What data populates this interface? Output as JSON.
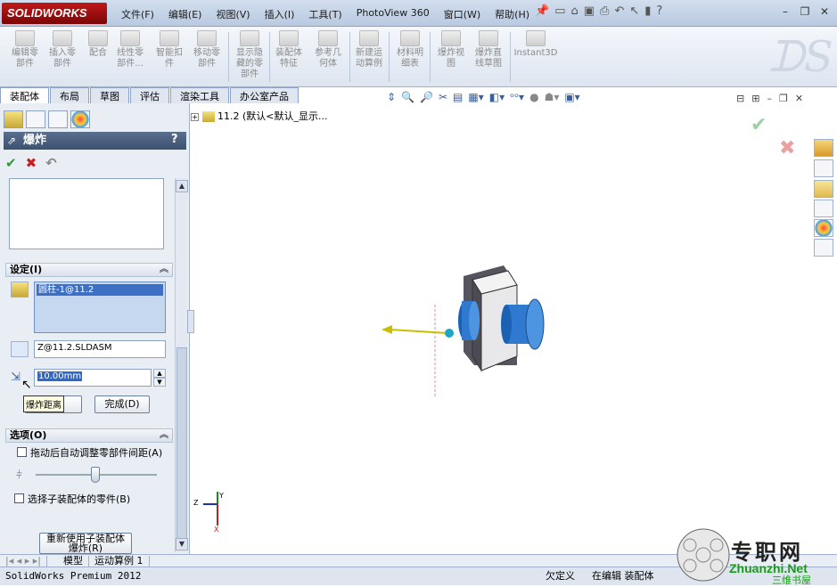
{
  "app": {
    "logo": "SOLIDWORKS"
  },
  "menu": [
    "文件(F)",
    "编辑(E)",
    "视图(V)",
    "插入(I)",
    "工具(T)",
    "PhotoView 360",
    "窗口(W)",
    "帮助(H)"
  ],
  "ribbon": {
    "buttons": [
      {
        "label": "编辑零\n部件"
      },
      {
        "label": "插入零\n部件"
      },
      {
        "label": "配合"
      },
      {
        "label": "线性零\n部件..."
      },
      {
        "label": "智能扣\n件"
      },
      {
        "label": "移动零\n部件"
      },
      {
        "label": "显示隐\n藏的零\n部件"
      },
      {
        "label": "装配体\n特征"
      },
      {
        "label": "参考几\n何体"
      },
      {
        "label": "新建运\n动算例"
      },
      {
        "label": "材料明\n细表"
      },
      {
        "label": "爆炸视\n图"
      },
      {
        "label": "爆炸直\n线草图"
      },
      {
        "label": "Instant3D"
      }
    ]
  },
  "cmd_tabs": [
    "装配体",
    "布局",
    "草图",
    "评估",
    "渲染工具",
    "办公室产品"
  ],
  "property_manager": {
    "title": "爆炸",
    "help": "?",
    "settings": {
      "header": "设定(I)",
      "selected_item": "圆柱-1@11.2",
      "direction_field": "Z@11.2.SLDASM",
      "distance_value": "10.00mm",
      "tooltip": "爆炸距离",
      "apply_label": "",
      "done_label": "完成(D)"
    },
    "options": {
      "header": "选项(O)",
      "auto_space": "拖动后自动调整零部件间距(A)",
      "select_sub": "选择子装配体的零件(B)",
      "reuse_label": "重新使用子装配体\n爆炸(R)"
    }
  },
  "tree": {
    "root": "11.2  (默认<默认_显示..."
  },
  "axis_labels": {
    "z": "Z",
    "y": "Y",
    "x": "X"
  },
  "bottom_tabs": [
    "模型",
    "运动算例 1"
  ],
  "status": {
    "product": "SolidWorks Premium 2012",
    "state1": "欠定义",
    "state2": "在编辑 装配体"
  },
  "watermark": {
    "title": "专职网",
    "url": "Zhuanzhi.Net",
    "sub": "三维书屋"
  }
}
